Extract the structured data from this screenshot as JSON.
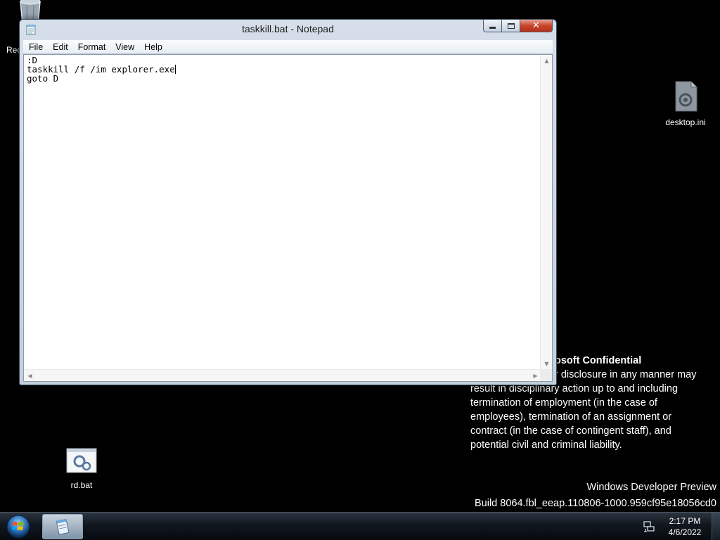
{
  "desktop": {
    "icons": [
      {
        "label": "Rec",
        "icon": "recycle-bin-icon"
      },
      {
        "label": "desktop.ini",
        "icon": "config-file-icon"
      },
      {
        "label": "rd.bat",
        "icon": "batch-file-icon"
      }
    ],
    "watermark": {
      "title": "osoft Confidential",
      "lines": [
        "r disclosure in any manner may",
        "result in disciplinary action up to and including",
        "termination of employment (in the case of",
        "employees), termination of an assignment or",
        "contract (in the case of contingent staff), and",
        "potential civil and criminal liability."
      ]
    },
    "build": {
      "line1": "Windows Developer Preview",
      "line2": "Build 8064.fbl_eeap.110806-1000.959cf95e18056cd0"
    }
  },
  "window": {
    "title": "taskkill.bat - Notepad",
    "app_icon": "notepad-icon",
    "menu": [
      "File",
      "Edit",
      "Format",
      "View",
      "Help"
    ],
    "content": {
      "line1": ":D",
      "line2": "taskkill /f /im explorer.exe",
      "line3": "goto D"
    }
  },
  "taskbar": {
    "start_icon": "windows-start-orb-icon",
    "pinned": [
      {
        "name": "notepad",
        "icon": "notepad-icon"
      }
    ],
    "tray": {
      "network_icon": "network-icon"
    },
    "clock": {
      "time": "2:17 PM",
      "date": "4/6/2022"
    }
  },
  "colors": {
    "desktop_bg": "#000000",
    "close_button": "#c7452c",
    "taskbar": "#11171e"
  }
}
